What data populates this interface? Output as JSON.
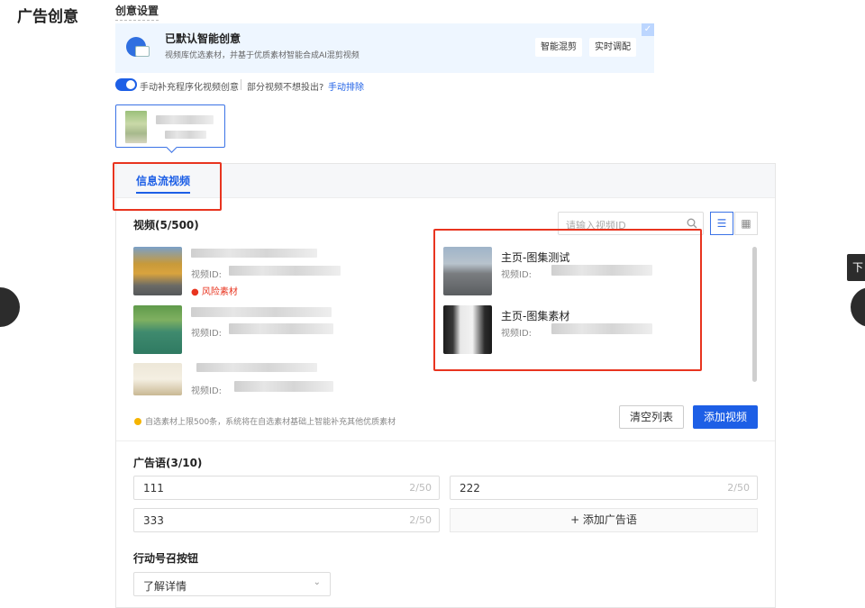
{
  "page": {
    "title": "广告创意",
    "section_label": "创意设置"
  },
  "smart_card": {
    "title": "已默认智能创意",
    "desc": "视频库优选素材，并基于优质素材智能合成AI混剪视频",
    "chips": [
      "智能混剪",
      "实时调配"
    ],
    "checked": true
  },
  "toggle": {
    "on": true,
    "label": "手动补充程序化视频创意",
    "question": "部分视频不想投出?",
    "link": "手动排除"
  },
  "panel": {
    "tab": "信息流视频",
    "videos": {
      "heading": "视频(5/500)",
      "search_placeholder": "请输入视频ID",
      "id_prefix": "视频ID:",
      "risk_label": "风险素材",
      "highlighted_items": [
        {
          "title": "主页-图集测试"
        },
        {
          "title": "主页-图集素材"
        }
      ],
      "hint": "自选素材上限500条，系统将在自选素材基础上智能补充其他优质素材",
      "clear_button": "清空列表",
      "add_button": "添加视频"
    },
    "slogans": {
      "heading": "广告语(3/10)",
      "items": [
        {
          "value": "111",
          "count": "2/50"
        },
        {
          "value": "222",
          "count": "2/50"
        },
        {
          "value": "333",
          "count": "2/50"
        }
      ],
      "add_label": "+ 添加广告语"
    },
    "cta": {
      "heading": "行动号召按钮",
      "selected": "了解详情"
    }
  },
  "nav": {
    "next_tag": "下"
  },
  "colors": {
    "accent": "#1d5fe6",
    "highlight_box": "#e8341f",
    "risk": "#e8341f"
  }
}
